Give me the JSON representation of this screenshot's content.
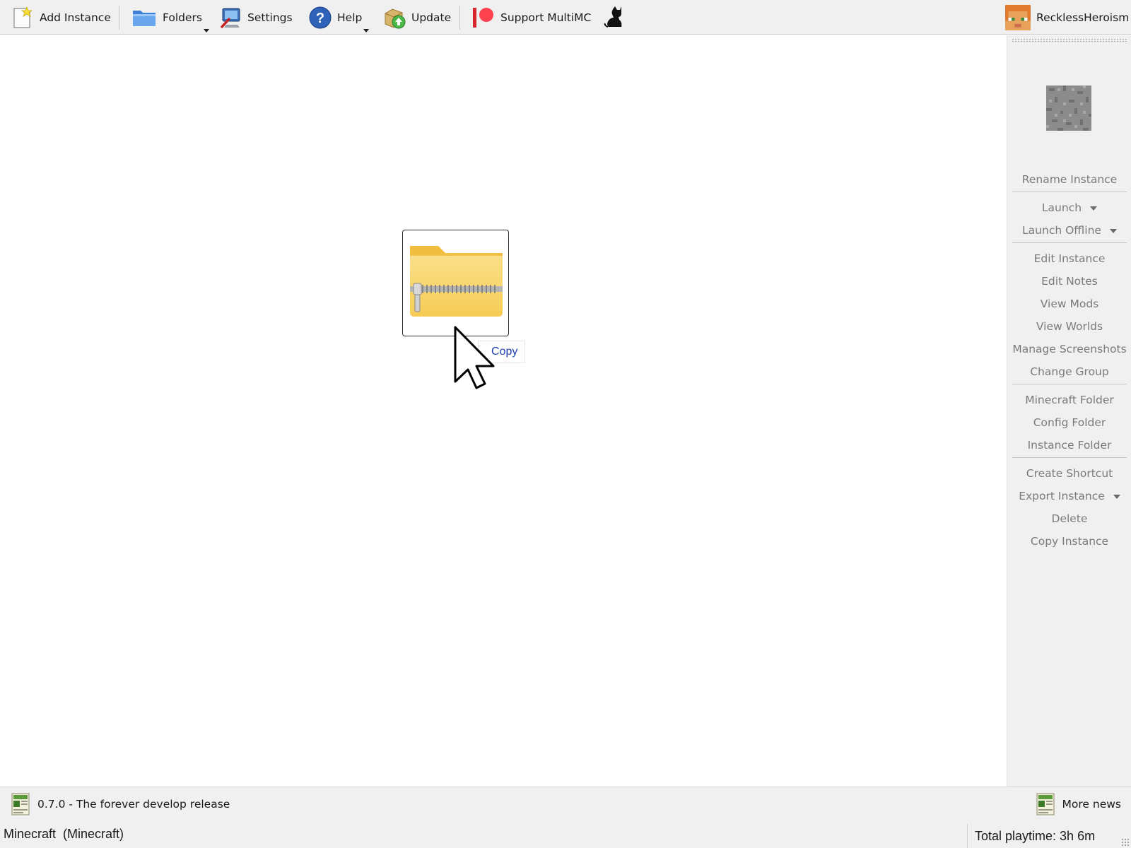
{
  "toolbar": {
    "add_instance": "Add Instance",
    "folders": "Folders",
    "settings": "Settings",
    "help": "Help",
    "update": "Update",
    "support": "Support MultiMC",
    "account": "RecklessHeroism"
  },
  "drag": {
    "copy_label": "Copy",
    "dragged_icon": "zip-folder-icon"
  },
  "sidebar": {
    "instance_icon": "stone-block-icon",
    "items": [
      {
        "label": "Rename Instance"
      },
      {
        "label": "Launch",
        "dropdown": true
      },
      {
        "label": "Launch Offline",
        "dropdown": true
      },
      {
        "label": "Edit Instance"
      },
      {
        "label": "Edit Notes"
      },
      {
        "label": "View Mods"
      },
      {
        "label": "View Worlds"
      },
      {
        "label": "Manage Screenshots"
      },
      {
        "label": "Change Group"
      },
      {
        "label": "Minecraft Folder"
      },
      {
        "label": "Config Folder"
      },
      {
        "label": "Instance Folder"
      },
      {
        "label": "Create Shortcut"
      },
      {
        "label": "Export Instance",
        "dropdown": true
      },
      {
        "label": "Delete"
      },
      {
        "label": "Copy Instance"
      }
    ]
  },
  "news": {
    "headline": "0.7.0 - The forever develop release",
    "more": "More news"
  },
  "status": {
    "instance": "Minecraft  (Minecraft)",
    "playtime": "Total playtime: 3h 6m"
  },
  "colors": {
    "toolbar_bg": "#f0f0f0",
    "sidebar_text_disabled": "#7a7a7a",
    "copy_text": "#1f3fb0",
    "folder_yellow": "#f8d46a"
  }
}
